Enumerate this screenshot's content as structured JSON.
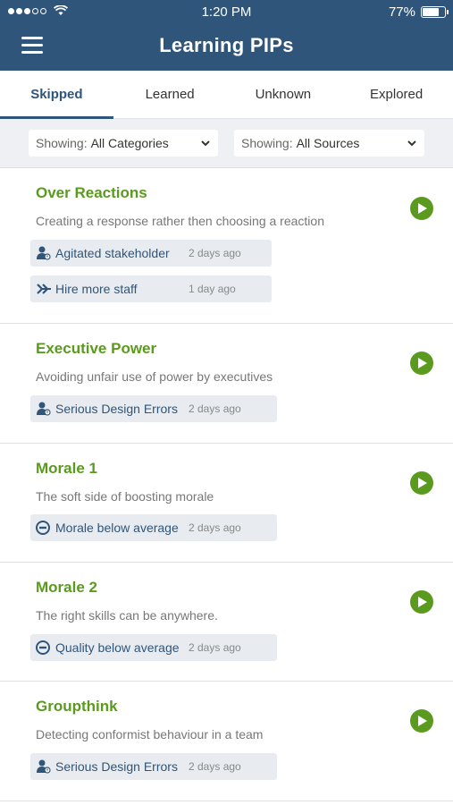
{
  "status_bar": {
    "time": "1:20 PM",
    "battery_percent": "77%",
    "battery_level": 0.77
  },
  "header": {
    "title": "Learning PIPs",
    "menu_icon": "hamburger-menu-icon"
  },
  "tabs": [
    {
      "label": "Skipped",
      "active": true
    },
    {
      "label": "Learned",
      "active": false
    },
    {
      "label": "Unknown",
      "active": false
    },
    {
      "label": "Explored",
      "active": false
    }
  ],
  "filters": {
    "category": {
      "prefix": "Showing:",
      "value": "All Categories"
    },
    "source": {
      "prefix": "Showing:",
      "value": "All Sources"
    }
  },
  "colors": {
    "header": "#2f557a",
    "accent_green": "#5a9a1e",
    "chip_bg": "#e8ecf0"
  },
  "cards": [
    {
      "title": "Over Reactions",
      "description": "Creating a response rather then choosing a reaction",
      "chips": [
        {
          "icon": "person-badge-icon",
          "label": "Agitated stakeholder",
          "ago": "2 days ago"
        },
        {
          "icon": "double-arrow-icon",
          "label": "Hire more staff",
          "ago": "1 day ago"
        }
      ]
    },
    {
      "title": "Executive Power",
      "description": "Avoiding unfair use of power by executives",
      "chips": [
        {
          "icon": "person-badge-icon",
          "label": "Serious Design Errors",
          "ago": "2 days ago"
        }
      ]
    },
    {
      "title": "Morale 1",
      "description": "The soft side of boosting morale",
      "chips": [
        {
          "icon": "minus-circle-icon",
          "label": "Morale below average",
          "ago": "2 days ago"
        }
      ]
    },
    {
      "title": "Morale 2",
      "description": "The right skills can be anywhere.",
      "chips": [
        {
          "icon": "minus-circle-icon",
          "label": "Quality below average",
          "ago": "2 days ago"
        }
      ]
    },
    {
      "title": "Groupthink",
      "description": "Detecting conformist behaviour in a team",
      "chips": [
        {
          "icon": "person-badge-icon",
          "label": "Serious Design Errors",
          "ago": "2 days ago"
        }
      ]
    }
  ]
}
